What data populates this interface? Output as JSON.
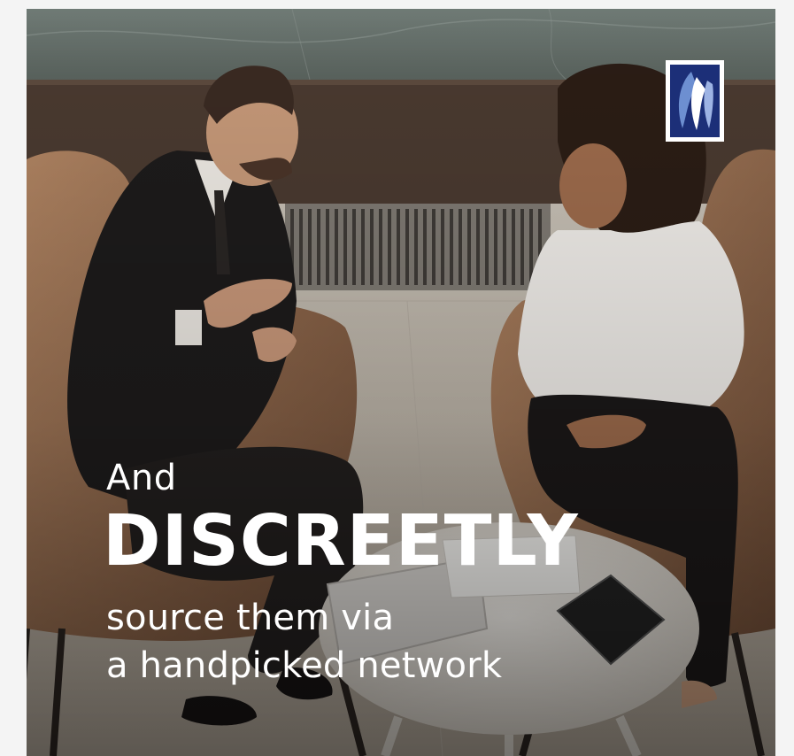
{
  "headline": {
    "intro": "And",
    "emphasis": "DISCREETLY",
    "line1": "source them via",
    "line2": "a handpicked network"
  },
  "logo": {
    "icon": "bank-logo-icon",
    "background": "#1c2f78",
    "frame": "#ffffff"
  },
  "photo": {
    "icon": "office-meeting-photo"
  },
  "colors": {
    "text": "#ffffff",
    "page_background": "#f4f4f4"
  }
}
